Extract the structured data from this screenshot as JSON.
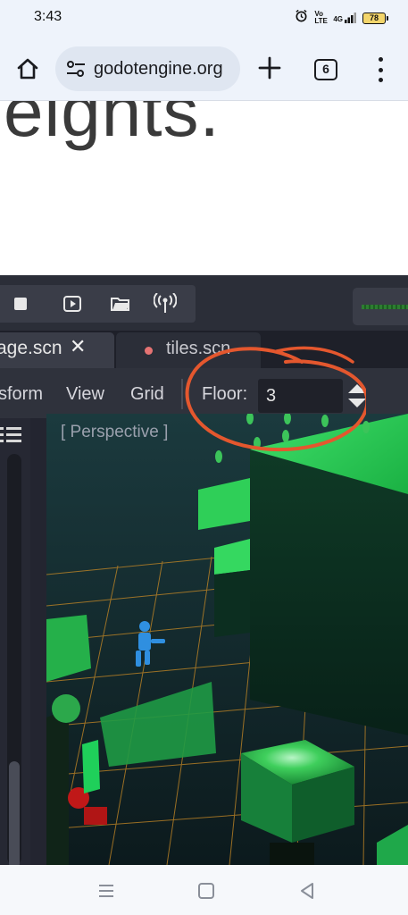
{
  "status_bar": {
    "time": "3:43",
    "alarm_icon": "alarm-icon",
    "volte_label": "Vo LTE",
    "network_label": "4G",
    "battery_level": "78"
  },
  "browser": {
    "url": "godotengine.org",
    "tab_count": "6"
  },
  "page": {
    "heading_fragment": "eights."
  },
  "editor": {
    "tabs": [
      {
        "label": "age.scn",
        "active": true
      },
      {
        "label": "tiles.scn",
        "active": false
      }
    ],
    "menu": {
      "transform": "sform",
      "view": "View",
      "grid": "Grid",
      "floor_label": "Floor:",
      "floor_value": "3"
    },
    "viewport_label": "[ Perspective ]"
  },
  "colors": {
    "annotation": "#e4572e",
    "godot_bg": "#232530",
    "scene_green": "#1fbf4a",
    "grid_orange": "#d99a2b"
  }
}
